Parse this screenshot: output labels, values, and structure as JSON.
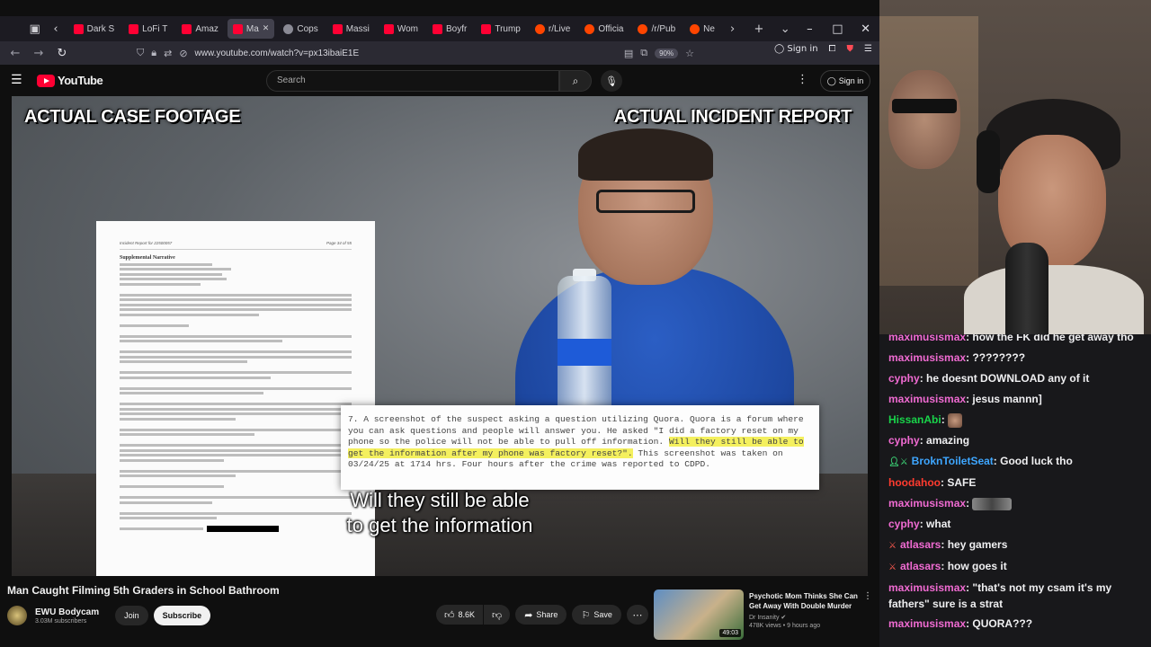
{
  "browser": {
    "tabs": [
      {
        "label": "Dark S",
        "favicon": "yt",
        "active": false
      },
      {
        "label": "LoFi T",
        "favicon": "yt",
        "active": false
      },
      {
        "label": "Amaz",
        "favicon": "yt",
        "active": false
      },
      {
        "label": "Ma",
        "favicon": "yt",
        "active": true
      },
      {
        "label": "Cops",
        "favicon": "gen",
        "active": false
      },
      {
        "label": "Massi",
        "favicon": "yt",
        "active": false
      },
      {
        "label": "Wom",
        "favicon": "yt",
        "active": false
      },
      {
        "label": "Boyfr",
        "favicon": "yt",
        "active": false
      },
      {
        "label": "Trump",
        "favicon": "yt",
        "active": false
      },
      {
        "label": "r/Live",
        "favicon": "rd",
        "active": false
      },
      {
        "label": "Officia",
        "favicon": "rd",
        "active": false
      },
      {
        "label": "/r/Pub",
        "favicon": "rd",
        "active": false
      },
      {
        "label": "Ne",
        "favicon": "rd",
        "active": false
      }
    ],
    "url": "www.youtube.com/watch?v=px13ibaiE1E",
    "zoom": "90%",
    "sign_in_label": "Sign in"
  },
  "youtube": {
    "logo_text": "YouTube",
    "search_placeholder": "Search",
    "sign_in_label": "Sign in"
  },
  "video": {
    "overlay_left": "ACTUAL CASE FOOTAGE",
    "overlay_right": "ACTUAL INCIDENT REPORT",
    "doc_header_left": "Incident Report for 22500057",
    "doc_header_right": "Page 34 of 55",
    "doc_section": "Supplemental Narrative",
    "zoom_text_1": "7. A screenshot of the suspect asking a question utilizing Quora. Quora is a forum where you can ask questions and people will answer you. He asked \"I did a factory reset on my phone so the police will not be able to pull off information. ",
    "zoom_highlight": "Will they still be able to get the information after my phone was factory reset?\".",
    "zoom_text_2": " This screenshot was taken on 03/24/25 at 1714 hrs. Four hours after the crime was reported to CDPD.",
    "subtitle_line1": "Will they still be able",
    "subtitle_line2": "to get the information",
    "title": "Man Caught Filming 5th Graders in School Bathroom",
    "channel_name": "EWU Bodycam",
    "subscribers": "3.03M subscribers",
    "join_label": "Join",
    "subscribe_label": "Subscribe",
    "likes": "8.6K",
    "share_label": "Share",
    "save_label": "Save"
  },
  "recommendation": {
    "title": "Psychotic Mom Thinks She Can Get Away With Double Murder",
    "channel": "Dr Insanity",
    "views": "478K views",
    "age": "9 hours ago",
    "duration": "49:03"
  },
  "chat": {
    "messages": [
      {
        "user": "maximusismax",
        "color": "#f06bd2",
        "text": "how the FK did he get away tho",
        "badge": ""
      },
      {
        "user": "maximusismax",
        "color": "#f06bd2",
        "text": "????????",
        "badge": ""
      },
      {
        "user": "cyphy",
        "color": "#f06bd2",
        "text": "he doesnt DOWNLOAD any of it",
        "badge": ""
      },
      {
        "user": "maximusismax",
        "color": "#f06bd2",
        "text": "jesus mannn]",
        "badge": ""
      },
      {
        "user": "HissanAbi",
        "color": "#19d44a",
        "text": "",
        "badge": "",
        "emote": "face"
      },
      {
        "user": "cyphy",
        "color": "#f06bd2",
        "text": "amazing",
        "badge": ""
      },
      {
        "user": "BroknToiletSeat",
        "color": "#3ea6ff",
        "text": "Good luck tho",
        "badge": "person-sword"
      },
      {
        "user": "hoodahoo",
        "color": "#ff3b2f",
        "text": "SAFE",
        "badge": ""
      },
      {
        "user": "maximusismax",
        "color": "#f06bd2",
        "text": "",
        "badge": "",
        "emote": "wide"
      },
      {
        "user": "cyphy",
        "color": "#f06bd2",
        "text": "what",
        "badge": ""
      },
      {
        "user": "atlasars",
        "color": "#f06bd2",
        "text": "hey gamers",
        "badge": "sword"
      },
      {
        "user": "atlasars",
        "color": "#f06bd2",
        "text": "how goes it",
        "badge": "sword"
      },
      {
        "user": "maximusismax",
        "color": "#f06bd2",
        "text": "\"that's not my csam it's my fathers\" sure is a strat",
        "badge": "",
        "wrap": true
      },
      {
        "user": "maximusismax",
        "color": "#f06bd2",
        "text": "QUORA???",
        "badge": ""
      }
    ]
  }
}
